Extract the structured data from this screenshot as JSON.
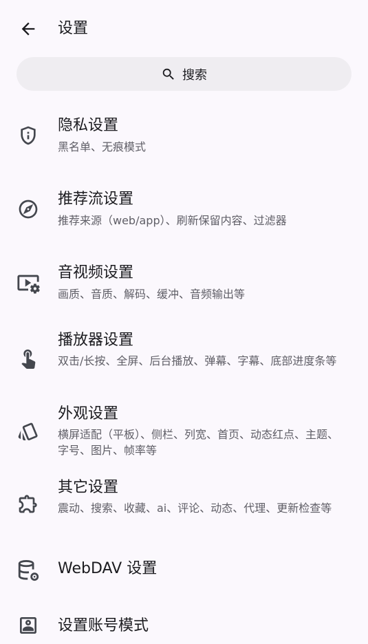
{
  "appbar": {
    "title": "设置",
    "back_icon": "arrow-back-icon"
  },
  "search": {
    "label": "搜索",
    "icon": "search-icon"
  },
  "items": [
    {
      "title": "隐私设置",
      "subtitle": "黑名单、无痕模式",
      "icon": "shield-icon"
    },
    {
      "title": "推荐流设置",
      "subtitle": "推荐来源（web/app）、刷新保留内容、过滤器",
      "icon": "compass-icon"
    },
    {
      "title": "音视频设置",
      "subtitle": "画质、音质、解码、缓冲、音频输出等",
      "icon": "video-settings-icon"
    },
    {
      "title": "播放器设置",
      "subtitle": "双击/长按、全屏、后台播放、弹幕、字幕、底部进度条等",
      "icon": "touch-icon"
    },
    {
      "title": "外观设置",
      "subtitle": "横屏适配（平板）、侧栏、列宽、首页、动态红点、主题、字号、图片、帧率等",
      "icon": "style-icon"
    },
    {
      "title": "其它设置",
      "subtitle": "震动、搜索、收藏、ai、评论、动态、代理、更新检查等",
      "icon": "extension-icon"
    },
    {
      "title": "WebDAV 设置",
      "subtitle": "",
      "icon": "database-settings-icon"
    },
    {
      "title": "设置账号模式",
      "subtitle": "",
      "icon": "account-box-icon"
    }
  ],
  "colors": {
    "background": "#fbf8fd",
    "search_background": "#efedf1",
    "title_text": "#1b1b1f",
    "subtitle_text": "#5f5e66",
    "icon": "#44474e"
  }
}
